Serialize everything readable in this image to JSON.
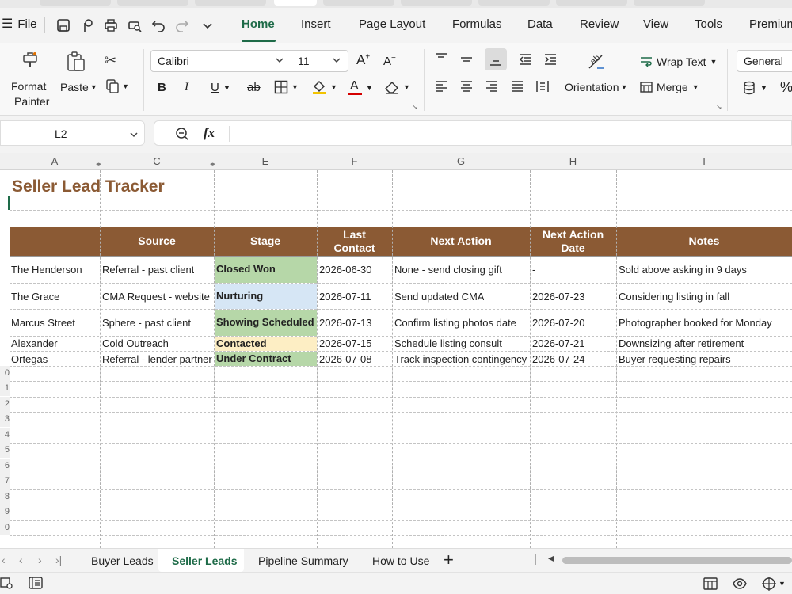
{
  "menu": {
    "file": "File",
    "tabs": [
      "Home",
      "Insert",
      "Page Layout",
      "Formulas",
      "Data",
      "Review",
      "View",
      "Tools",
      "Premium"
    ],
    "active": "Home"
  },
  "ribbon": {
    "format_painter_line1": "Format",
    "format_painter_line2": "Painter",
    "paste": "Paste",
    "font_name": "Calibri",
    "font_size": "11",
    "wrap_text": "Wrap Text",
    "orientation": "Orientation",
    "merge": "Merge",
    "number_format": "General",
    "percent": "%",
    "bold": "B",
    "italic": "I",
    "underline": "U",
    "strike": "ab",
    "font_color": "#d40000"
  },
  "formula_bar": {
    "name_box": "L2",
    "fx": "fx",
    "formula": ""
  },
  "columns": [
    "A",
    "C",
    "E",
    "F",
    "G",
    "H",
    "I"
  ],
  "sheet": {
    "title": "Seller Lead Tracker",
    "title_color": "#8b5a34",
    "header_color": "#8b5a34",
    "headers": {
      "source": "Source",
      "stage": "Stage",
      "last_contact_1": "Last",
      "last_contact_2": "Contact",
      "next_action": "Next Action",
      "next_action_date_1": "Next Action",
      "next_action_date_2": "Date",
      "notes": "Notes"
    },
    "rows": [
      {
        "name": "The Henderson",
        "source": "Referral - past client",
        "stage": "Closed Won",
        "stage_color": "#b6d7a8",
        "last": "2026-06-30",
        "action": "None - send closing gift",
        "date": "-",
        "notes": "Sold above asking in 9 days"
      },
      {
        "name": "The Grace",
        "source": "CMA Request - website",
        "stage": "Nurturing",
        "stage_color": "#d6e6f5",
        "last": "2026-07-11",
        "action": "Send updated CMA",
        "date": "2026-07-23",
        "notes": "Considering listing in fall"
      },
      {
        "name": "Marcus Street",
        "source": "Sphere - past client",
        "stage": "Showing Scheduled",
        "stage_color": "#b6d7a8",
        "last": "2026-07-13",
        "action": "Confirm listing photos date",
        "date": "2026-07-20",
        "notes": "Photographer booked for Monday"
      },
      {
        "name": "Alexander",
        "source": "Cold Outreach",
        "stage": "Contacted",
        "stage_color": "#fdeec4",
        "last": "2026-07-15",
        "action": "Schedule listing consult",
        "date": "2026-07-21",
        "notes": "Downsizing after retirement"
      },
      {
        "name": "Ortegas",
        "source": "Referral - lender partner",
        "stage": "Under Contract",
        "stage_color": "#b6d7a8",
        "last": "2026-07-08",
        "action": "Track inspection contingency",
        "date": "2026-07-24",
        "notes": "Buyer requesting repairs"
      }
    ],
    "row_numbers": [
      "0",
      "1",
      "2",
      "3",
      "4",
      "5",
      "6",
      "7",
      "8",
      "9",
      "0"
    ]
  },
  "sheet_tabs": [
    "Buyer Leads",
    "Seller Leads",
    "Pipeline Summary",
    "How to Use"
  ],
  "active_sheet": "Seller Leads",
  "add_sheet": "+"
}
